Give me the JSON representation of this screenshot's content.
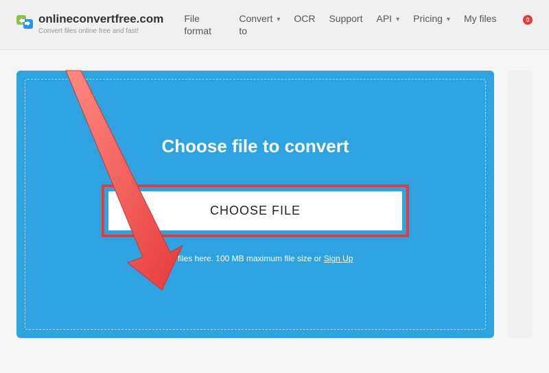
{
  "header": {
    "logo_title": "onlineconvertfree.com",
    "logo_subtitle": "Convert files online free and fast!",
    "nav": {
      "file_format": "File format",
      "convert_to": "Convert to",
      "ocr": "OCR",
      "support": "Support",
      "api": "API",
      "pricing": "Pricing",
      "my_files": "My files",
      "badge_count": "0"
    }
  },
  "upload": {
    "title": "Choose file to convert",
    "choose_button": "CHOOSE FILE",
    "drop_prefix": "Drop files here. 100 MB maximum file size or ",
    "signup_label": "Sign Up"
  }
}
